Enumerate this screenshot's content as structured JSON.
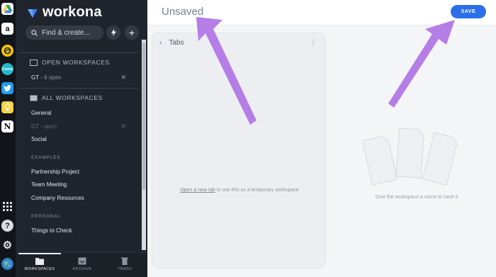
{
  "dock": {
    "items": [
      {
        "icon": "google-drive-icon",
        "color": "#1fa463",
        "glyph": "▲"
      },
      {
        "icon": "amazon-icon",
        "color": "#ffffff",
        "glyph": "a"
      },
      {
        "icon": "circle-logo-icon",
        "color": "#f5c400",
        "glyph": "◎"
      },
      {
        "icon": "canva-icon",
        "color": "#22b8cf",
        "glyph": ""
      },
      {
        "icon": "twitter-icon",
        "color": "#1d9bf0",
        "glyph": "🐦"
      },
      {
        "icon": "lightbulb-icon",
        "color": "#f8d34a",
        "glyph": "💡"
      },
      {
        "icon": "notion-icon",
        "color": "#ffffff",
        "glyph": "N"
      }
    ],
    "bottom": [
      {
        "icon": "app-grid-icon"
      },
      {
        "icon": "help-icon"
      },
      {
        "icon": "settings-icon"
      },
      {
        "icon": "globe-avatar-icon"
      }
    ]
  },
  "sidebar": {
    "brand": "workona",
    "search_placeholder": "Find & create...",
    "open_workspaces": {
      "label": "OPEN WORKSPACES",
      "items": [
        {
          "name": "GT",
          "meta": "- 6 open"
        }
      ]
    },
    "all_workspaces": {
      "label": "ALL WORKSPACES",
      "items": [
        {
          "name": "General",
          "meta": ""
        },
        {
          "name": "GT",
          "meta": "- open",
          "dim": true
        },
        {
          "name": "Social",
          "meta": ""
        }
      ]
    },
    "groups": [
      {
        "label": "EXAMPLES",
        "items": [
          "Partnership Project",
          "Team Meeting",
          "Company Resources"
        ]
      },
      {
        "label": "PERSONAL",
        "items": [
          "Things to Check"
        ]
      }
    ],
    "bottom_nav": [
      {
        "label": "WORKSPACES",
        "icon": "folder-icon",
        "active": true
      },
      {
        "label": "ARCHIVE",
        "icon": "archive-icon",
        "active": false
      },
      {
        "label": "TRASH",
        "icon": "trash-icon",
        "active": false
      }
    ]
  },
  "main": {
    "title": "Unsaved",
    "save_label": "SAVE",
    "tabs_panel": {
      "title": "Tabs",
      "empty_link": "Open a new tab",
      "empty_rest": " to use this as a temporary workspace"
    },
    "hint": "Give the workspace a name to save it"
  },
  "colors": {
    "accent": "#2b6fe8",
    "annotation_arrow": "#b57ee6",
    "sidebar_bg": "#20252d"
  }
}
